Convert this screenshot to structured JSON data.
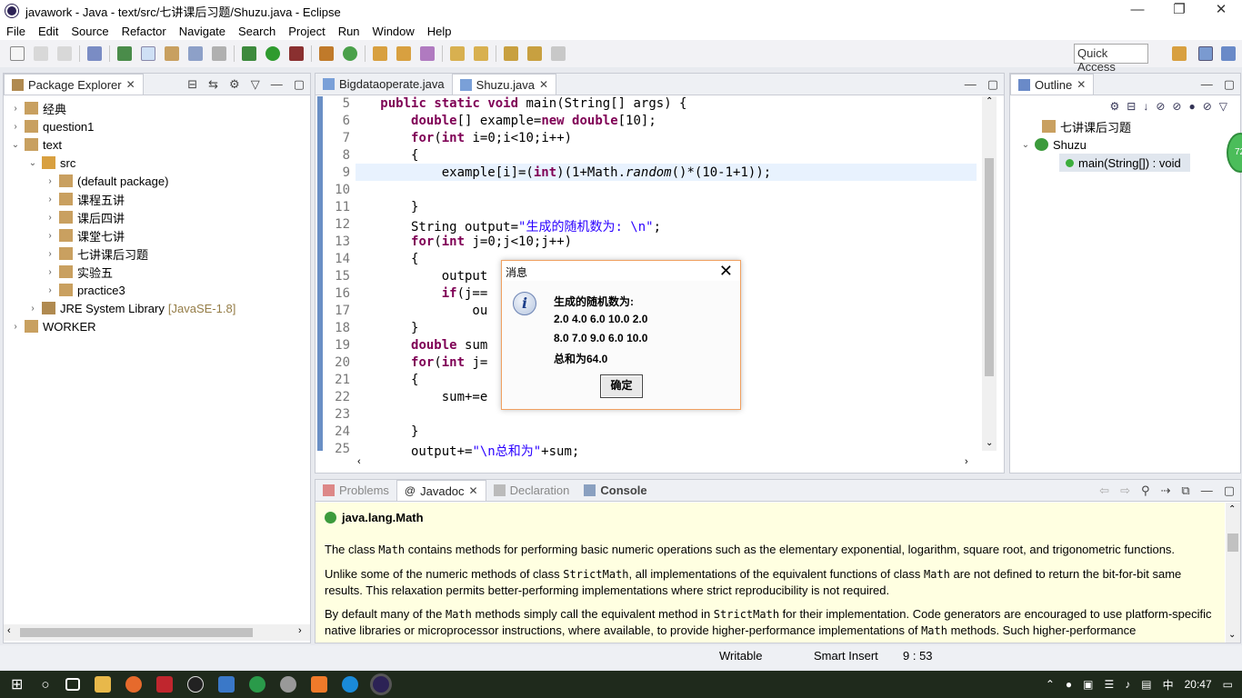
{
  "window": {
    "title": "javawork - Java - text/src/七讲课后习题/Shuzu.java - Eclipse",
    "controls": [
      "—",
      "❐",
      "✕"
    ]
  },
  "menu": [
    "File",
    "Edit",
    "Source",
    "Refactor",
    "Navigate",
    "Search",
    "Project",
    "Run",
    "Window",
    "Help"
  ],
  "quick_access": "Quick Access",
  "package_explorer": {
    "tab_label": "Package Explorer",
    "items": [
      {
        "label": "经典",
        "arrow": "›",
        "indent": 0,
        "icon": "project-icon"
      },
      {
        "label": "question1",
        "arrow": "›",
        "indent": 0,
        "icon": "project-icon"
      },
      {
        "label": "text",
        "arrow": "⌄",
        "indent": 0,
        "icon": "project-icon"
      },
      {
        "label": "src",
        "arrow": "⌄",
        "indent": 1,
        "icon": "source-folder-icon"
      },
      {
        "label": "(default package)",
        "arrow": "›",
        "indent": 2,
        "icon": "package-icon"
      },
      {
        "label": "课程五讲",
        "arrow": "›",
        "indent": 2,
        "icon": "package-icon"
      },
      {
        "label": "课后四讲",
        "arrow": "›",
        "indent": 2,
        "icon": "package-icon"
      },
      {
        "label": "课堂七讲",
        "arrow": "›",
        "indent": 2,
        "icon": "package-icon"
      },
      {
        "label": "七讲课后习题",
        "arrow": "›",
        "indent": 2,
        "icon": "package-icon"
      },
      {
        "label": "实验五",
        "arrow": "›",
        "indent": 2,
        "icon": "package-icon"
      },
      {
        "label": "practice3",
        "arrow": "›",
        "indent": 2,
        "icon": "package-icon"
      },
      {
        "label": "JRE System Library",
        "suffix": "[JavaSE-1.8]",
        "arrow": "›",
        "indent": 1,
        "icon": "library-icon"
      },
      {
        "label": "WORKER",
        "arrow": "›",
        "indent": 0,
        "icon": "project-icon"
      }
    ]
  },
  "editor": {
    "tabs": [
      {
        "label": "Bigdataoperate.java",
        "active": false
      },
      {
        "label": "Shuzu.java",
        "active": true
      }
    ],
    "line_numbers": [
      "5",
      "6",
      "7",
      "8",
      "9",
      "10",
      "11",
      "12",
      "13",
      "14",
      "15",
      "16",
      "17",
      "18",
      "19",
      "20",
      "21",
      "22",
      "23",
      "24",
      "25"
    ]
  },
  "outline": {
    "tab_label": "Outline",
    "items": [
      {
        "label": "七讲课后习题"
      },
      {
        "label": "Shuzu"
      },
      {
        "label": "main(String[]) : void"
      }
    ]
  },
  "bottom_panel": {
    "tabs": [
      {
        "label": "Problems",
        "active": false
      },
      {
        "label": "Javadoc",
        "active": true
      },
      {
        "label": "Declaration",
        "active": false
      },
      {
        "label": "Console",
        "active": false
      }
    ],
    "javadoc": {
      "heading": "java.lang.Math",
      "p1a": "The class ",
      "p1code": "Math",
      "p1b": " contains methods for performing basic numeric operations such as the elementary exponential, logarithm, square root, and trigonometric functions.",
      "p2a": "Unlike some of the numeric methods of class ",
      "p2code1": "StrictMath",
      "p2b": ", all implementations of the equivalent functions of class ",
      "p2code2": "Math",
      "p2c": " are not defined to return the bit-for-bit same results. This relaxation permits better-performing implementations where strict reproducibility is not required.",
      "p3a": "By default many of the ",
      "p3code1": "Math",
      "p3b": " methods simply call the equivalent method in ",
      "p3code2": "StrictMath",
      "p3c": " for their implementation. Code generators are encouraged to use platform-specific native libraries or microprocessor instructions, where available, to provide higher-performance implementations of ",
      "p3code3": "Math",
      "p3d": " methods. Such higher-performance"
    }
  },
  "status": {
    "writable": "Writable",
    "insert_mode": "Smart Insert",
    "position": "9 : 53"
  },
  "dialog": {
    "title": "消息",
    "close": "✕",
    "icon_glyph": "i",
    "line1": "生成的随机数为:",
    "line2": "2.0 4.0 6.0 10.0 2.0",
    "line3": "8.0 7.0 9.0 6.0 10.0",
    "line4": "总和为64.0",
    "ok": "确定"
  },
  "taskbar": {
    "time": "20:47",
    "ime": "中"
  },
  "badge": "72"
}
